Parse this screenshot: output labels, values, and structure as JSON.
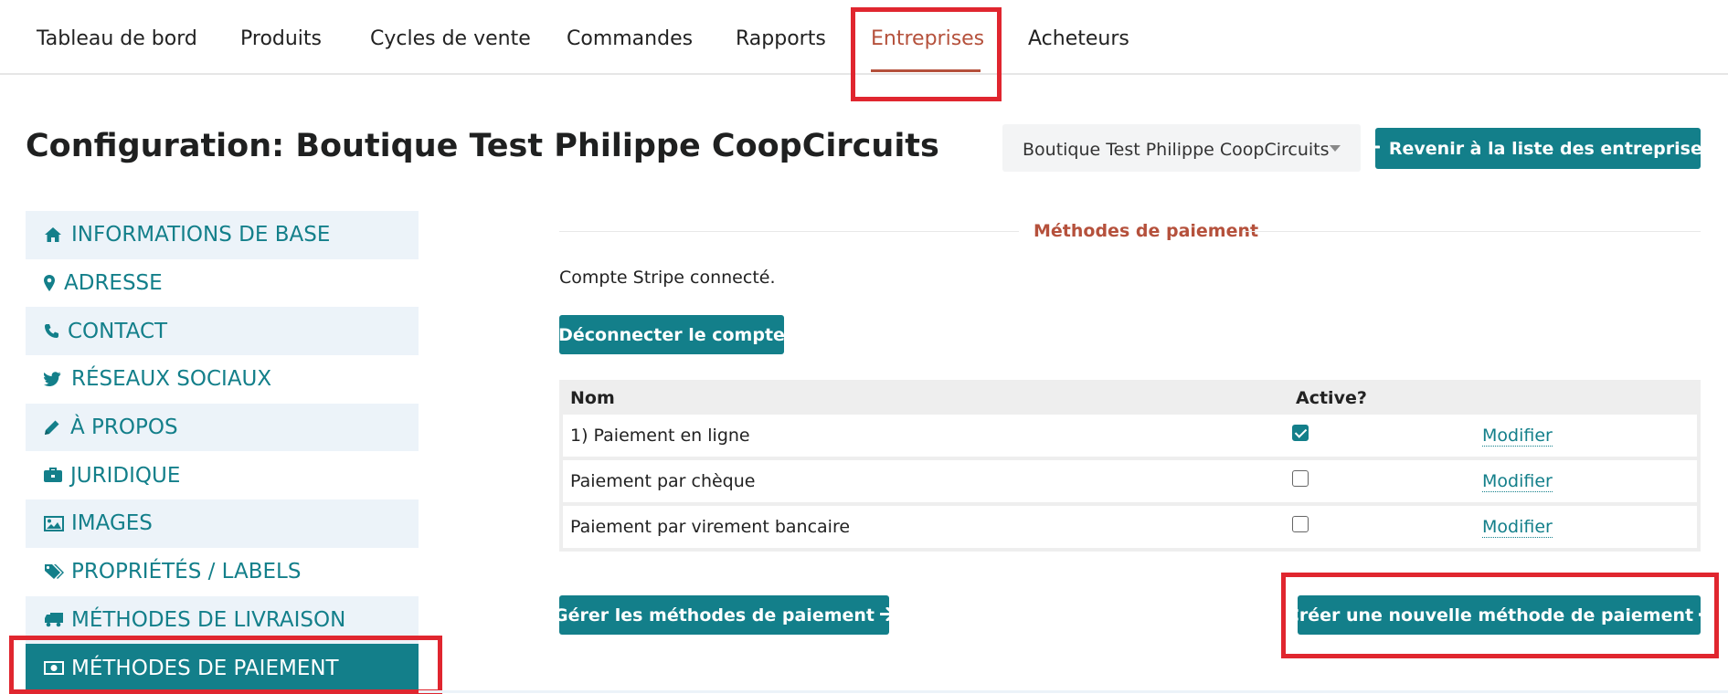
{
  "nav": {
    "items": [
      {
        "label": "Tableau de bord"
      },
      {
        "label": "Produits"
      },
      {
        "label": "Cycles de vente"
      },
      {
        "label": "Commandes"
      },
      {
        "label": "Rapports"
      },
      {
        "label": "Entreprises"
      },
      {
        "label": "Acheteurs"
      }
    ],
    "active_index": 5
  },
  "header": {
    "title": "Configuration: Boutique Test Philippe CoopCircuits",
    "enterprise_select_value": "Boutique Test Philippe CoopCircuits",
    "back_button_label": "Revenir à la liste des entreprises"
  },
  "sidebar": {
    "items": [
      {
        "label": "INFORMATIONS DE BASE",
        "icon": "home-icon"
      },
      {
        "label": "ADRESSE",
        "icon": "map-marker-icon"
      },
      {
        "label": "CONTACT",
        "icon": "phone-icon"
      },
      {
        "label": "RÉSEAUX SOCIAUX",
        "icon": "twitter-icon"
      },
      {
        "label": "À PROPOS",
        "icon": "pencil-icon"
      },
      {
        "label": "JURIDIQUE",
        "icon": "briefcase-icon"
      },
      {
        "label": "IMAGES",
        "icon": "image-icon"
      },
      {
        "label": "PROPRIÉTÉS / LABELS",
        "icon": "tags-icon"
      },
      {
        "label": "MÉTHODES DE LIVRAISON",
        "icon": "truck-icon"
      },
      {
        "label": "MÉTHODES DE PAIEMENT",
        "icon": "money-icon"
      }
    ],
    "selected_index": 9
  },
  "main": {
    "section_title": "Méthodes de paiement",
    "stripe_status": "Compte Stripe connecté.",
    "disconnect_button_label": "Déconnecter le compte",
    "table": {
      "columns": [
        "Nom",
        "Active?"
      ],
      "rows": [
        {
          "name": "1) Paiement en ligne",
          "active": true,
          "edit_label": "Modifier"
        },
        {
          "name": "Paiement par chèque",
          "active": false,
          "edit_label": "Modifier"
        },
        {
          "name": "Paiement par virement bancaire",
          "active": false,
          "edit_label": "Modifier"
        }
      ]
    },
    "manage_button_label": "Gérer les méthodes de paiement",
    "create_button_label": "Créer une nouvelle méthode de paiement"
  },
  "colors": {
    "accent": "#137f8a",
    "active_nav": "#b5513c",
    "highlight_box": "#e0262f"
  }
}
